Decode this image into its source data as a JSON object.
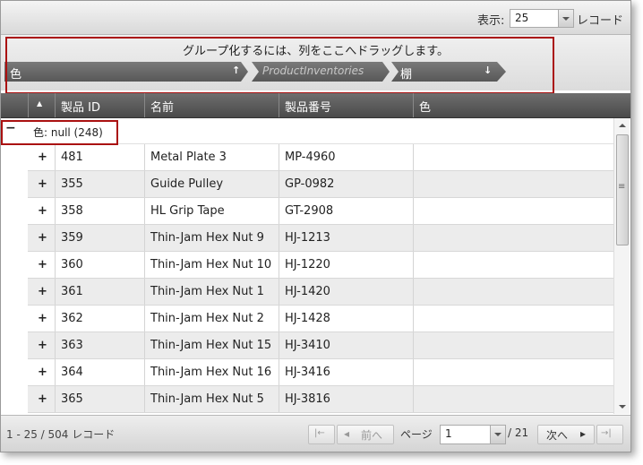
{
  "toolbar": {
    "show_label": "表示:",
    "page_size": "25",
    "records_label": "レコード"
  },
  "group_panel": {
    "hint": "グループ化するには、列をここへドラッグします。",
    "chips": [
      {
        "label": "色",
        "sort_icon": "↑"
      },
      {
        "label": "ProductInventories"
      },
      {
        "label": "棚",
        "sort_icon": "↓"
      }
    ]
  },
  "columns": [
    "製品 ID",
    "名前",
    "製品番号",
    "色"
  ],
  "header_sort_icon": "▲",
  "group_row": {
    "toggle": "−",
    "text": "色: null (248)"
  },
  "expand_glyph": "+",
  "rows": [
    {
      "id": "481",
      "name": "Metal Plate 3",
      "number": "MP-4960",
      "color": ""
    },
    {
      "id": "355",
      "name": "Guide Pulley",
      "number": "GP-0982",
      "color": ""
    },
    {
      "id": "358",
      "name": "HL Grip Tape",
      "number": "GT-2908",
      "color": ""
    },
    {
      "id": "359",
      "name": "Thin-Jam Hex Nut 9",
      "number": "HJ-1213",
      "color": ""
    },
    {
      "id": "360",
      "name": "Thin-Jam Hex Nut 10",
      "number": "HJ-1220",
      "color": ""
    },
    {
      "id": "361",
      "name": "Thin-Jam Hex Nut 1",
      "number": "HJ-1420",
      "color": ""
    },
    {
      "id": "362",
      "name": "Thin-Jam Hex Nut 2",
      "number": "HJ-1428",
      "color": ""
    },
    {
      "id": "363",
      "name": "Thin-Jam Hex Nut 15",
      "number": "HJ-3410",
      "color": ""
    },
    {
      "id": "364",
      "name": "Thin-Jam Hex Nut 16",
      "number": "HJ-3416",
      "color": ""
    },
    {
      "id": "365",
      "name": "Thin-Jam Hex Nut 5",
      "number": "HJ-3816",
      "color": ""
    }
  ],
  "footer": {
    "summary": "1 - 25 / 504 レコード",
    "first_icon": "|←",
    "prev_icon": "◂",
    "prev_label": "前へ",
    "page_label": "ページ",
    "page_value": "1",
    "total_pages": "/ 21",
    "next_label": "次へ",
    "next_icon": "▸",
    "last_icon": "→|"
  },
  "colors": {
    "accent_red": "#aa1111",
    "header_bg": "#5a5a5a",
    "alt_row": "#ececec"
  }
}
